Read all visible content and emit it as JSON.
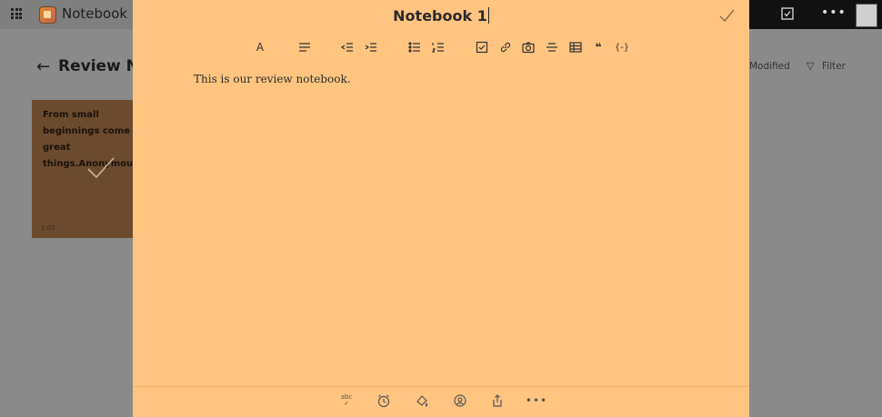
{
  "app": {
    "title": "Notebook"
  },
  "page": {
    "title": "Review Notebooks",
    "sort_label": "Modified",
    "filter_label": "Filter"
  },
  "card": {
    "text": "From small beginnings come great things.Anonymous",
    "date": "1:03"
  },
  "editor": {
    "title": "Notebook 1",
    "body": "This is our review notebook.",
    "background_color": "#ffc480"
  },
  "toolbar_icons": [
    "text-format-icon",
    "align-icon",
    "indent-decrease-icon",
    "indent-increase-icon",
    "bulleted-list-icon",
    "numbered-list-icon",
    "checkbox-icon",
    "link-icon",
    "camera-icon",
    "strikethrough-icon",
    "table-icon",
    "quote-icon",
    "code-icon"
  ],
  "footer": {
    "spell_label": "abc"
  },
  "footer_icons": [
    "spellcheck-icon",
    "reminder-icon",
    "color-fill-icon",
    "share-user-icon",
    "export-icon",
    "more-icon"
  ]
}
